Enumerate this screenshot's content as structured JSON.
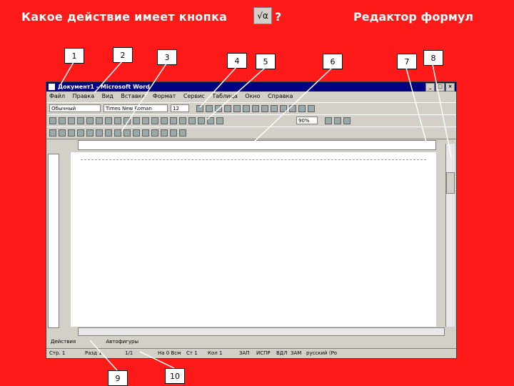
{
  "question": {
    "text": "Какое действие имеет кнопка",
    "button_glyph": "√α",
    "mark": "?",
    "answer": "Редактор формул"
  },
  "callouts": [
    "1",
    "2",
    "3",
    "4",
    "5",
    "6",
    "7",
    "8",
    "9",
    "10"
  ],
  "window": {
    "title": "Документ1 - Microsoft Word",
    "menu": [
      "Файл",
      "Правка",
      "Вид",
      "Вставка",
      "Формат",
      "Сервис",
      "Таблица",
      "Окно",
      "Справка"
    ],
    "style_combo": "Обычный",
    "font_combo": "Times New Roman",
    "size_combo": "12",
    "zoom_combo": "90%",
    "draw_label": "Действия",
    "autoshapes_label": "Автофигуры",
    "status": [
      "Стр. 1",
      "Разд 1",
      "1/1",
      "На 0 Всм",
      "Ст 1",
      "Кол 1",
      "ЗАП",
      "ИСПР",
      "ВДЛ",
      "ЗАМ",
      "русский (Ро"
    ]
  }
}
